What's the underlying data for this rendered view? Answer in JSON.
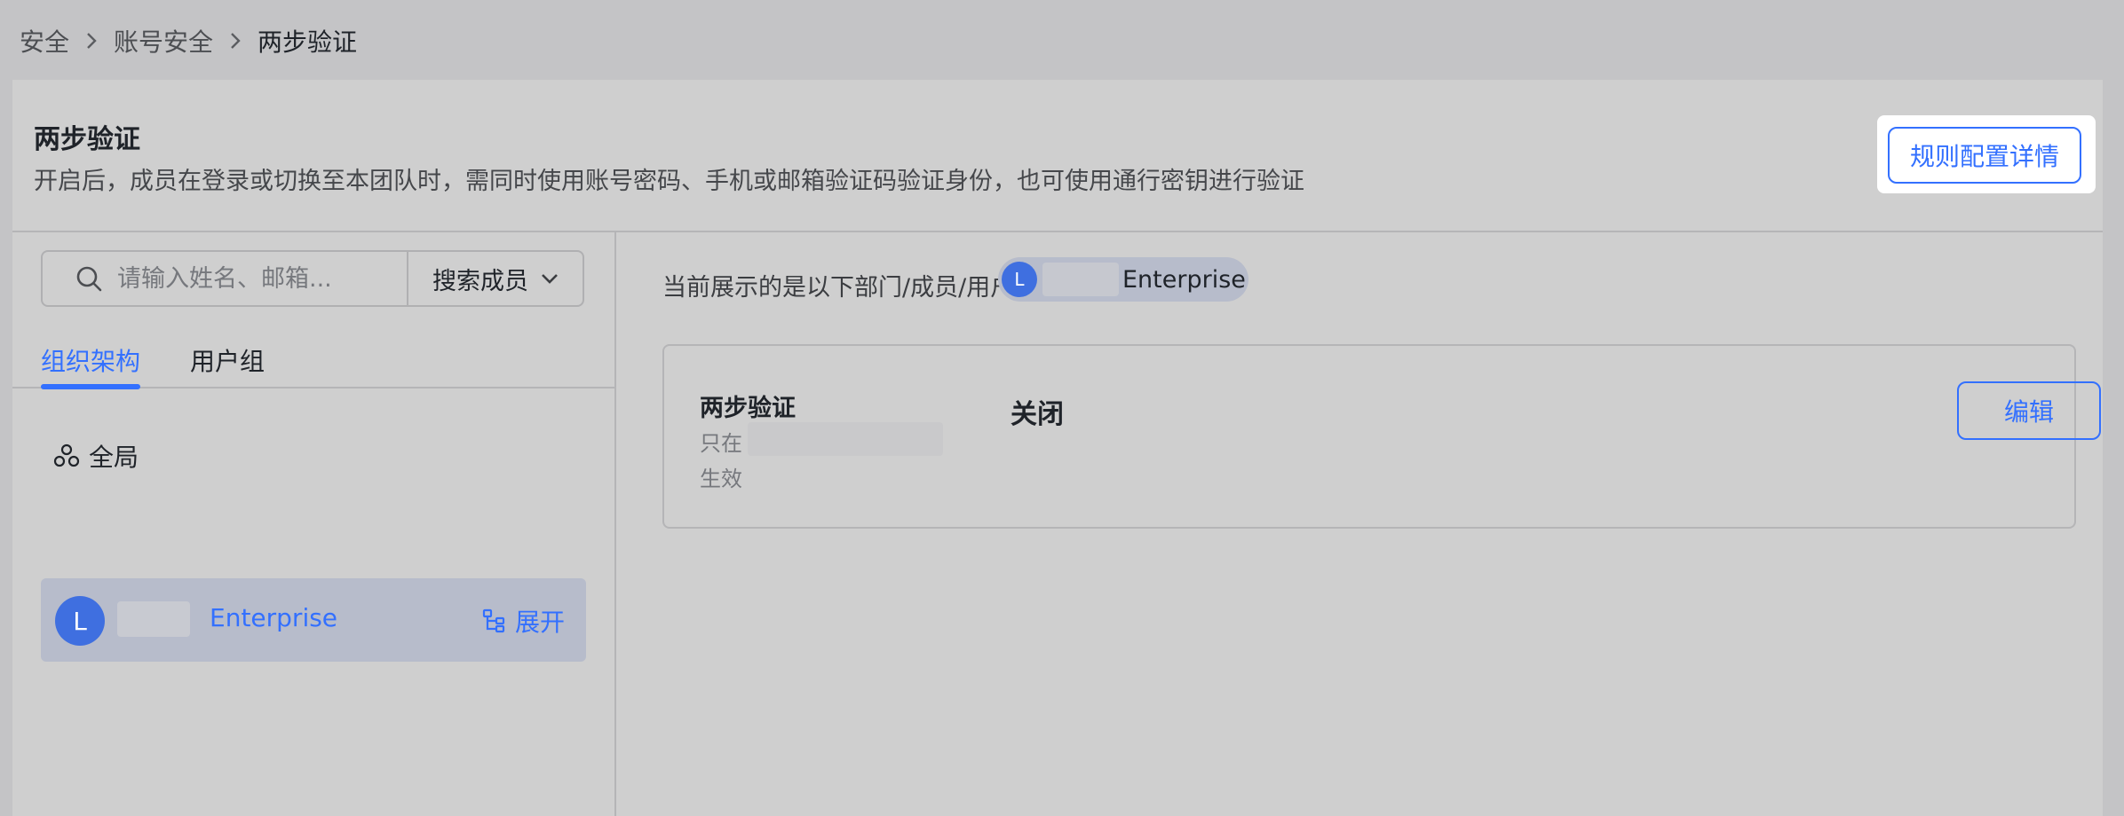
{
  "breadcrumb": {
    "items": [
      "安全",
      "账号安全",
      "两步验证"
    ]
  },
  "header": {
    "title": "两步验证",
    "description": "开启后，成员在登录或切换至本团队时，需同时使用账号密码、手机或邮箱验证码验证身份，也可使用通行密钥进行验证",
    "rules_button": "规则配置详情"
  },
  "search": {
    "placeholder": "请输入姓名、邮箱...",
    "value": "",
    "scope_select": "搜索成员",
    "icon": "search-icon"
  },
  "tabs": [
    {
      "label": "组织架构",
      "active": true
    },
    {
      "label": "用户组",
      "active": false
    }
  ],
  "tree": {
    "global_label": "全局",
    "global_icon": "org-cluster-icon",
    "selected": {
      "avatar_letter": "L",
      "name": "Enterprise",
      "expand_label": "展开",
      "expand_icon": "tree-structure-icon"
    }
  },
  "settings": {
    "current_label": "当前展示的是以下部门/成员/用户组的设置：",
    "target": {
      "avatar_letter": "L",
      "name": "Enterprise"
    },
    "card": {
      "title": "两步验证",
      "note_prefix": "只在",
      "note_suffix": "生效",
      "status": "关闭",
      "edit_button": "编辑"
    }
  },
  "colors": {
    "accent": "#3370ff",
    "overlay_background": "#c4c4c6",
    "avatar": "#3f6fe0",
    "selected_row": "#b7bccb"
  }
}
